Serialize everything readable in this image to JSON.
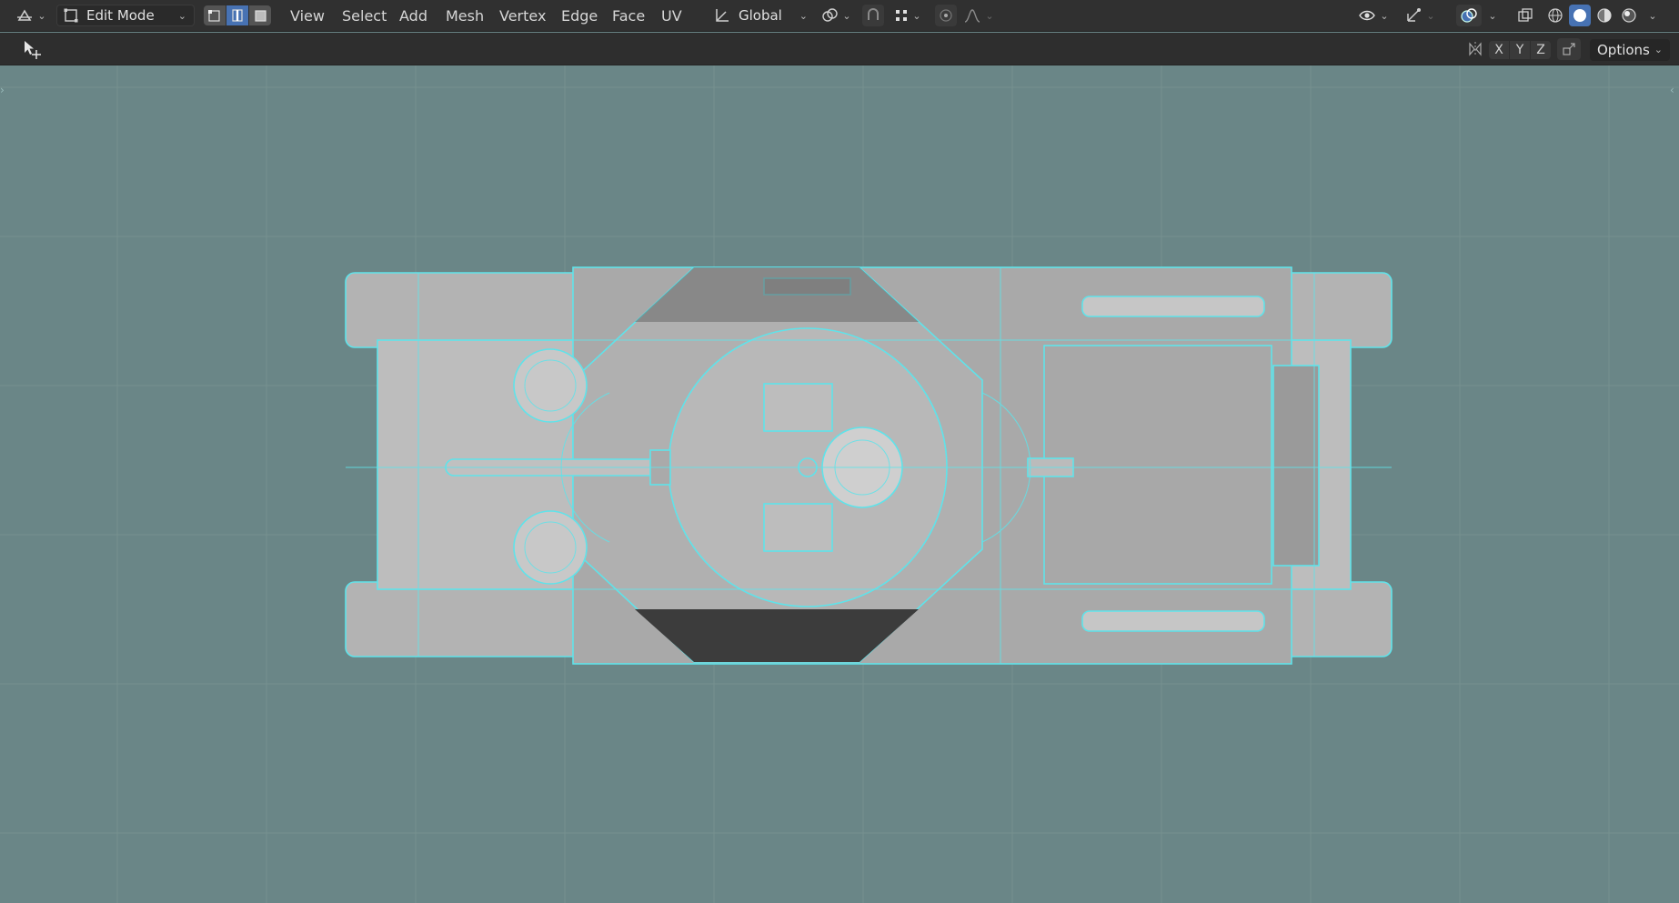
{
  "header": {
    "mode_label": "Edit Mode",
    "menus": [
      "View",
      "Select",
      "Add",
      "Mesh",
      "Vertex",
      "Edge",
      "Face",
      "UV"
    ],
    "transform_orientation": "Global"
  },
  "tool_settings": {
    "axis_x": "X",
    "axis_y": "Y",
    "axis_z": "Z",
    "options_label": "Options"
  },
  "colors": {
    "viewport_bg": "#6a8687",
    "header_bg": "#303030",
    "accent_blue": "#4772b3",
    "wire_cyan": "#55e0e6",
    "mesh_grey": "#b4b4b4"
  },
  "icons": {
    "editor_type": "editor-type-icon",
    "edit_mode": "edit-mode-icon",
    "vertex_select": "vertex-select-icon",
    "edge_select": "edge-select-icon",
    "face_select": "face-select-icon",
    "orientation": "transform-orientation-icon",
    "pivot": "pivot-point-icon",
    "snap": "snap-icon",
    "snap_target": "snap-increment-icon",
    "proportional": "proportional-editing-icon",
    "falloff": "falloff-icon",
    "visibility": "object-visibility-icon",
    "gizmo": "gizmo-icon",
    "overlays": "overlays-icon",
    "xray": "xray-icon",
    "shading_wire": "wireframe-shading-icon",
    "shading_solid": "solid-shading-icon",
    "shading_material": "material-shading-icon",
    "shading_render": "rendered-shading-icon",
    "select_tool": "select-tool-icon",
    "mirror": "mirror-icon",
    "auto_merge": "auto-merge-icon"
  }
}
